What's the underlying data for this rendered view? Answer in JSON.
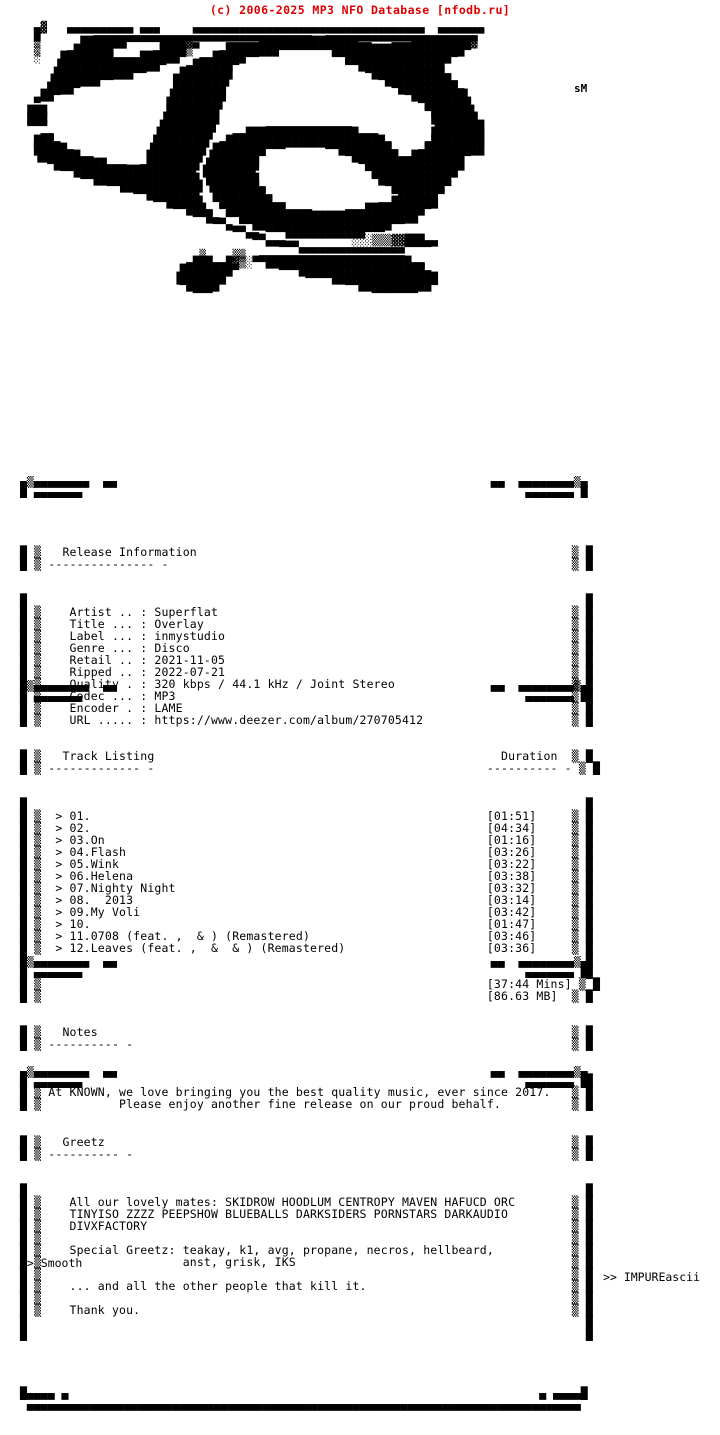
{
  "header": {
    "database_line": "(c) 2006-2025 MP3 NFO Database [nfodb.ru]",
    "color": "#dd0000"
  },
  "art": {
    "signature": "sM",
    "group_logo_alt": "KNOWN",
    "lines": [
      "   ▄▓   ▄▄▄▄▄▄▄▄▄▄ ▄▄▄     ▄▄▄▄▄▄▄▄▄▄▄▄▄▄▄▄▄▄▄▄▄▄▄▄▄▄▄▄▄▄▄▄▄▄▄  ▄▄▄▄▄▄▄ ",
      "   █        ▄▄▄▄▄▄▄▄▄▄▄▄▄▄▄▄▄▄▄▄▄▄▄▄▄▄▄▄▄▄▄▄▄  ▄▄▄▄▄▄▄▄▄▄▄▄▄▄▄▄▄▄▄▄▄▄▄  ",
      "   ▒      ███████▀▀▀▀▀████▓▄    ▄▄▄▄▄███████████████▄▄   ▄▄▄█████████▓   ",
      "   ▒    ▄██████      ▄████▒    ▄████████▀▀▀▀▀▀▀▀████████████████████▀    ",
      "   ░   ████████▄▄▄▄██████▀  ▄▄█████▀▀           ▀▀████████████████▀      ",
      "      ▐███████████████▀   ▄██████▀                ▀▀█████████████        ",
      "      ████████████▀▀     ████████                    ▀███████████▄       ",
      "     ▐███████▀▀         ████████▌                      ▀██████████▄      ",
      "     ████▀              ████████                         ▀█████████▄     ",
      "    ██▀                ▐████████                           ▀████████▌    ",
      "   ▀                   ████████▌                             ▀███████    ",
      "  ███                  ████████                               ▀██████▌   ",
      "  ███                 ▐████████                                ███████   ",
      "  ▀▀▀                 ████████▌       ▄▄▄▄▄▄▄▄▄▄▄▄▄            ▐███████   ",
      "    ▄▄               ▐████████   ▄▄█████████████████▄▄▄        ████████   ",
      "   ███▄              ████████▌ ▄████████████████████████▄     ▄████████   ",
      "   █████▄           ▐████████ ████████▀▀▀      ▀▀████████▄   ▄█████████   ",
      "   ▐██████▄▄        ████████▌▐███████▀            ▀███████▄▄████████▀     ",
      "     ▀████████▄▄▄  ▄████████ ████████               ▀███████████████      ",
      "       ▀▀██████████████████▌▐███████▌                ▀█████████████       ",
      "          ▀▀████████████████ ████████                 ▀███████████        ",
      "              ▀▀████████████▌▐███████▄                  ▀████████▀        ",
      "                  ▀▀████████  ████████▄                  ▀██████▀         ",
      "                     ▀▀█████▌ ▀████████▄▄              ▄▄███████          ",
      "                        ▀▀███▄ ▀█████████▄▄▄▄     ▄▄▄█████████▀           ",
      "                           ▀▀█▄ ▀▀███████████████████████████             ",
      "                              ▀▀▄ ▀▀█████████████████████▀▀               ",
      "                                 ▀▀▄▄ ▀▀▀████████████▀▀▀                  ",
      "                                    ▀▀▄▄▄          ░░░▒▒▒▓▓███▄▄          ",
      "                                        ▀▀▀▄▄▄▄▄▄▄▄▄▄▄▄▄▄▄▄▀▀▀▀           ",
      "                            ▒    ▒▒  ▄▄▄▄▄▄▄▄▄▄▄▄▄▄▄▄▄▄▄▄▄▄              ",
      "                          ▄███▄▄█▓▒░▀▀██████████████████████▄▄            ",
      "                         ████████▀      ▀▀▀███████████████████▄           ",
      "                        ▐███████            ▀▀▀▀████████████████          ",
      "                         ▀█████                   ▀▀███████████▀          ",
      "                           ▀▀▀                        ▀▀▀▀▀▀▀             "
    ]
  },
  "sections": {
    "release_information": {
      "title": "Release Information",
      "rule": "--------------- -",
      "fields": [
        {
          "label": "Artist  ..",
          "sep": ":",
          "value": "Superflat"
        },
        {
          "label": "Title   ...",
          "sep": ":",
          "value": "Overlay"
        },
        {
          "label": "Label   ...",
          "sep": ":",
          "value": "inmystudio"
        },
        {
          "label": "Genre   ...",
          "sep": ":",
          "value": "Disco"
        },
        {
          "label": "Retail  ..",
          "sep": ":",
          "value": "2021-11-05"
        },
        {
          "label": "Ripped  ..",
          "sep": ":",
          "value": "2022-07-21"
        },
        {
          "label": "Quality .",
          "sep": ":",
          "value": "320 kbps / 44.1 kHz / Joint Stereo"
        },
        {
          "label": "Codec   ...",
          "sep": ":",
          "value": "MP3"
        },
        {
          "label": "Encoder .",
          "sep": ":",
          "value": "LAME"
        },
        {
          "label": "URL     .....",
          "sep": ":",
          "value": "https://www.deezer.com/album/270705412"
        }
      ],
      "lines": [
        "   Artist .. : Superflat",
        "   Title ... : Overlay",
        "   Label ... : inmystudio",
        "   Genre ... : Disco",
        "   Retail .. : 2021-11-05",
        "   Ripped .. : 2022-07-21",
        "   Quality . : 320 kbps / 44.1 kHz / Joint Stereo",
        "   Codec ... : MP3",
        "   Encoder . : LAME",
        "   URL ..... : https://www.deezer.com/album/270705412"
      ]
    },
    "track_listing": {
      "title": "Track Listing",
      "rule": "------------- -",
      "duration_title": "Duration",
      "duration_rule": "---------- -",
      "bullet": ">",
      "tracks": [
        {
          "num": "01.",
          "name": "",
          "duration": "[01:51]"
        },
        {
          "num": "02.",
          "name": "",
          "duration": "[04:34]"
        },
        {
          "num": "03.",
          "name": "On",
          "duration": "[01:16]"
        },
        {
          "num": "04.",
          "name": "Flash",
          "duration": "[03:26]"
        },
        {
          "num": "05.",
          "name": "Wink",
          "duration": "[03:22]"
        },
        {
          "num": "06.",
          "name": "Helena",
          "duration": "[03:38]"
        },
        {
          "num": "07.",
          "name": "Nighty Night",
          "duration": "[03:32]"
        },
        {
          "num": "08.",
          "name": "  2013",
          "duration": "[03:14]"
        },
        {
          "num": "09.",
          "name": "My Voli",
          "duration": "[03:42]"
        },
        {
          "num": "10.",
          "name": "",
          "duration": "[01:47]"
        },
        {
          "num": "11.",
          "name": "0708 (feat. ,  & ) (Remastered)",
          "duration": "[03:46]"
        },
        {
          "num": "12.",
          "name": "Leaves (feat. ,  &  & ) (Remastered)",
          "duration": "[03:36]"
        }
      ],
      "total_time": "[37:44 Mins]",
      "total_size": "[86.63 MB]"
    },
    "notes": {
      "title": "Notes",
      "rule": "---------- -",
      "lines": [
        "At KNOWN, we love bringing you the best quality music, ever since 2017.",
        "          Please enjoy another fine release on our proud behalf."
      ]
    },
    "greetz": {
      "title": "Greetz",
      "rule": "---------- -",
      "lines": [
        "   All our lovely mates: SKIDROW HOODLUM CENTROPY MAVEN HAFUCD ORC",
        "   TINYISO ZZZZ PEEPSHOW BLUEBALLS DARKSIDERS PORNSTARS DARKAUDIO",
        "   DIVXFACTORY",
        "",
        "   Special Greetz: teakay, k1, avg, propane, necros, hellbeard,",
        "                   anst, grisk, IKS",
        "",
        "   ... and all the other people that kill it.",
        "",
        "   Thank you."
      ]
    }
  },
  "footer": {
    "left": ">> Smooth",
    "right": ">> IMPUREascii"
  },
  "frames": {
    "top_left": "▄▒▄▄▄▄▄▄  ▄▄",
    "top_right": "▄▄  ▄▄▄▄▄▄▒▄",
    "edge_left": "▒",
    "bottom_rule": "▄▄▄▄▄▄▄▄▄▄▄▄▄▄▄▄▄▄▄▄▄▄▄▄▄▄▄▄▄▄▄▄▄▄▄▄▄▄▄▄▄▄▄▄▄▄▄▄▄▄▄▄▄▄▄▄▄▄▄▄▄▄▄▄▄▄▄▄▄▄▄▄▄▄▄▄▄▄▄▄"
  }
}
